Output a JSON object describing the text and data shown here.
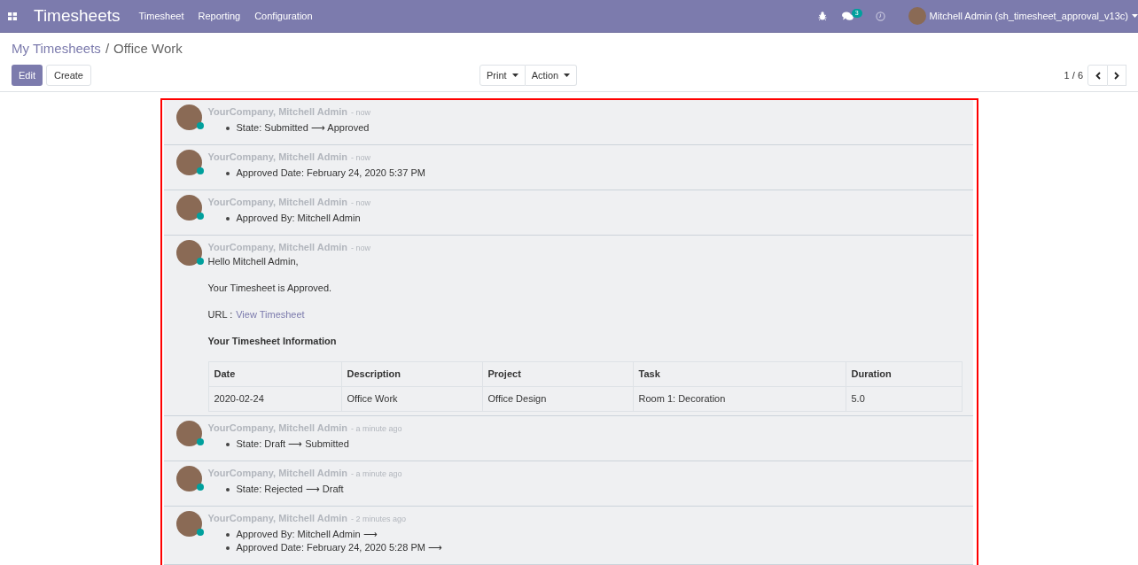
{
  "navbar": {
    "app_title": "Timesheets",
    "menu": [
      "Timesheet",
      "Reporting",
      "Configuration"
    ],
    "messages_count": "3",
    "user": "Mitchell Admin (sh_timesheet_approval_v13c)"
  },
  "breadcrumb": {
    "parent": "My Timesheets",
    "separator": "/",
    "current": "Office Work"
  },
  "buttons": {
    "edit": "Edit",
    "create": "Create",
    "print": "Print",
    "action": "Action"
  },
  "pager": "1 / 6",
  "messages": [
    {
      "kind": "tracking",
      "author": "YourCompany, Mitchell Admin",
      "time": "- now",
      "online": true,
      "changes": [
        "State: Submitted ⟶ Approved"
      ]
    },
    {
      "kind": "tracking",
      "author": "YourCompany, Mitchell Admin",
      "time": "- now",
      "online": true,
      "changes": [
        "Approved Date: February 24, 2020 5:37 PM"
      ]
    },
    {
      "kind": "tracking",
      "author": "YourCompany, Mitchell Admin",
      "time": "- now",
      "online": true,
      "changes": [
        "Approved By: Mitchell Admin"
      ]
    },
    {
      "kind": "email",
      "author": "YourCompany, Mitchell Admin",
      "time": "- now",
      "online": true,
      "greeting": "Hello Mitchell Admin,",
      "line": "Your Timesheet is Approved.",
      "url_label": "URL :",
      "url_link": "View Timesheet",
      "info_heading": "Your Timesheet Information",
      "table": {
        "columns": [
          "Date",
          "Description",
          "Project",
          "Task",
          "Duration"
        ],
        "rows": [
          [
            "2020-02-24",
            "Office Work",
            "Office Design",
            "Room 1: Decoration",
            "5.0"
          ]
        ]
      }
    },
    {
      "kind": "tracking",
      "author": "YourCompany, Mitchell Admin",
      "time": "- a minute ago",
      "online": true,
      "changes": [
        "State: Draft ⟶ Submitted"
      ]
    },
    {
      "kind": "tracking",
      "author": "YourCompany, Mitchell Admin",
      "time": "- a minute ago",
      "online": true,
      "changes": [
        "State: Rejected ⟶ Draft"
      ]
    },
    {
      "kind": "tracking",
      "author": "YourCompany, Mitchell Admin",
      "time": "- 2 minutes ago",
      "online": true,
      "changes": [
        "Approved By: Mitchell Admin ⟶",
        "Approved Date: February 24, 2020 5:28 PM ⟶"
      ]
    }
  ]
}
